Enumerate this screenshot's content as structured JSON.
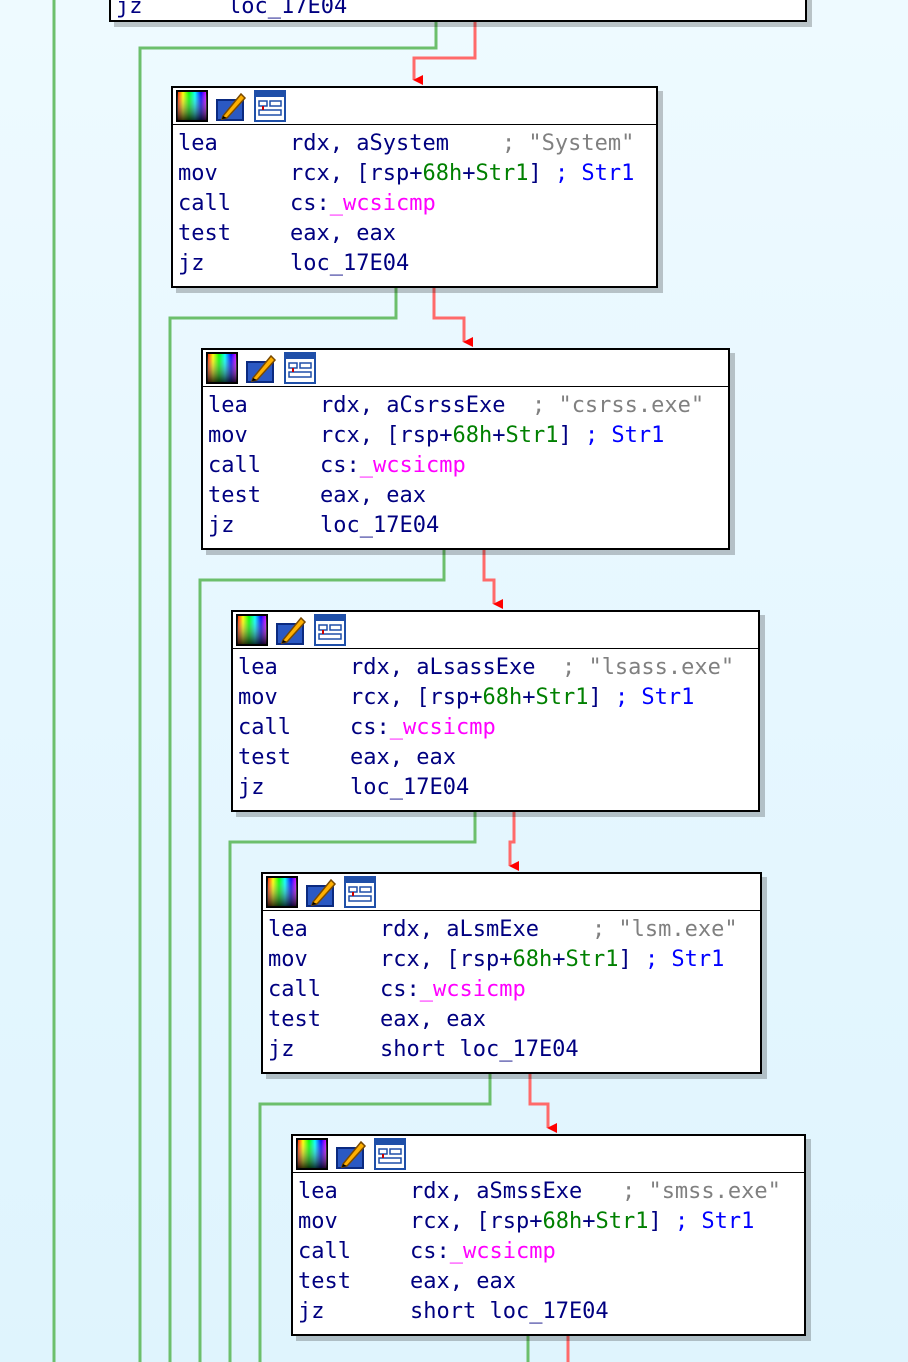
{
  "colors": {
    "background": "#e6f7ff",
    "edge_false": "#6cbf6c",
    "edge_true_line": "#ff6a6a",
    "edge_arrow": "#ff0000",
    "mnemonic": "#000080",
    "number": "#008000",
    "function": "#ff00ff",
    "comment": "#808080",
    "comment_ref": "#0000ff"
  },
  "icons": [
    "color-palette-icon",
    "edit-pencil-icon",
    "graph-view-icon"
  ],
  "top_block": {
    "mnemonic": "jz",
    "operand": "loc_17E04"
  },
  "blocks": [
    {
      "lea": {
        "mnemonic": "lea",
        "reg": "rdx, ",
        "sym": "aSystem",
        "pad": "    ",
        "comment": "; \"System\""
      },
      "mov": {
        "mnemonic": "mov",
        "pre": "rcx, [rsp+",
        "num": "68h",
        "plus": "+",
        "sym": "Str1",
        "post": "] ",
        "comment": "; Str1"
      },
      "call": {
        "mnemonic": "call",
        "pre": "cs:",
        "func": "_wcsicmp"
      },
      "test": {
        "mnemonic": "test",
        "operand": "eax, eax"
      },
      "jz": {
        "mnemonic": "jz",
        "operand": "loc_17E04"
      }
    },
    {
      "lea": {
        "mnemonic": "lea",
        "reg": "rdx, ",
        "sym": "aCsrssExe",
        "pad": "  ",
        "comment": "; \"csrss.exe\""
      },
      "mov": {
        "mnemonic": "mov",
        "pre": "rcx, [rsp+",
        "num": "68h",
        "plus": "+",
        "sym": "Str1",
        "post": "] ",
        "comment": "; Str1"
      },
      "call": {
        "mnemonic": "call",
        "pre": "cs:",
        "func": "_wcsicmp"
      },
      "test": {
        "mnemonic": "test",
        "operand": "eax, eax"
      },
      "jz": {
        "mnemonic": "jz",
        "operand": "loc_17E04"
      }
    },
    {
      "lea": {
        "mnemonic": "lea",
        "reg": "rdx, ",
        "sym": "aLsassExe",
        "pad": "  ",
        "comment": "; \"lsass.exe\""
      },
      "mov": {
        "mnemonic": "mov",
        "pre": "rcx, [rsp+",
        "num": "68h",
        "plus": "+",
        "sym": "Str1",
        "post": "] ",
        "comment": "; Str1"
      },
      "call": {
        "mnemonic": "call",
        "pre": "cs:",
        "func": "_wcsicmp"
      },
      "test": {
        "mnemonic": "test",
        "operand": "eax, eax"
      },
      "jz": {
        "mnemonic": "jz",
        "operand": "loc_17E04"
      }
    },
    {
      "lea": {
        "mnemonic": "lea",
        "reg": "rdx, ",
        "sym": "aLsmExe",
        "pad": "    ",
        "comment": "; \"lsm.exe\""
      },
      "mov": {
        "mnemonic": "mov",
        "pre": "rcx, [rsp+",
        "num": "68h",
        "plus": "+",
        "sym": "Str1",
        "post": "] ",
        "comment": "; Str1"
      },
      "call": {
        "mnemonic": "call",
        "pre": "cs:",
        "func": "_wcsicmp"
      },
      "test": {
        "mnemonic": "test",
        "operand": "eax, eax"
      },
      "jz": {
        "mnemonic": "jz",
        "operand": "short loc_17E04"
      }
    },
    {
      "lea": {
        "mnemonic": "lea",
        "reg": "rdx, ",
        "sym": "aSmssExe",
        "pad": "   ",
        "comment": "; \"smss.exe\""
      },
      "mov": {
        "mnemonic": "mov",
        "pre": "rcx, [rsp+",
        "num": "68h",
        "plus": "+",
        "sym": "Str1",
        "post": "] ",
        "comment": "; Str1"
      },
      "call": {
        "mnemonic": "call",
        "pre": "cs:",
        "func": "_wcsicmp"
      },
      "test": {
        "mnemonic": "test",
        "operand": "eax, eax"
      },
      "jz": {
        "mnemonic": "jz",
        "operand": "short loc_17E04"
      }
    }
  ]
}
